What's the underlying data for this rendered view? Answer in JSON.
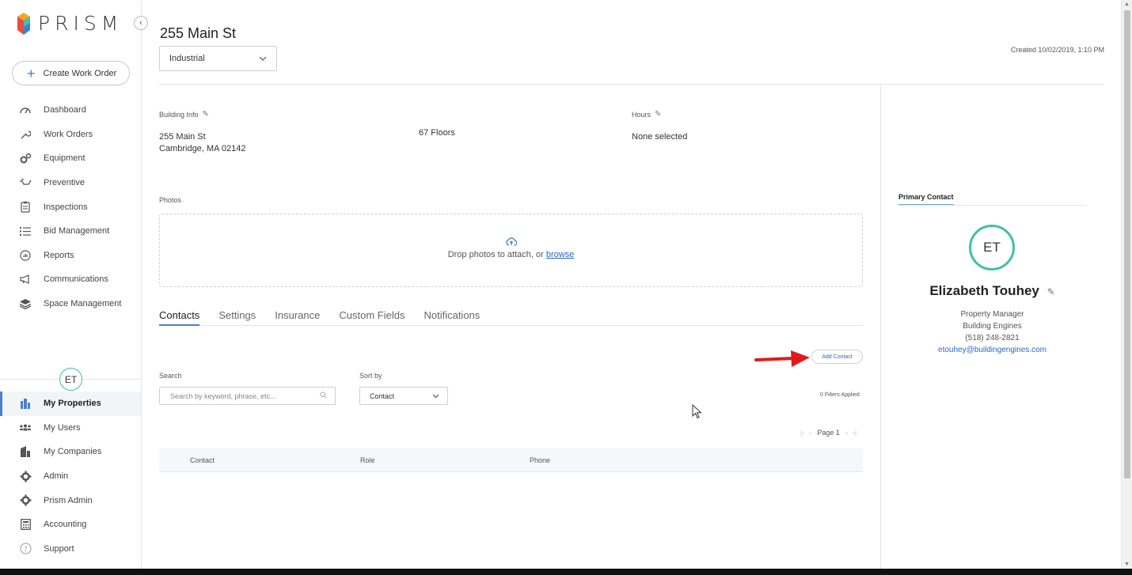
{
  "app": {
    "logo_text": "PRISM"
  },
  "sidebar": {
    "create_label": "Create Work Order",
    "nav": [
      {
        "label": "Dashboard",
        "icon": "gauge-icon"
      },
      {
        "label": "Work Orders",
        "icon": "wrench-icon"
      },
      {
        "label": "Equipment",
        "icon": "gears-icon"
      },
      {
        "label": "Preventive",
        "icon": "oil-can-icon"
      },
      {
        "label": "Inspections",
        "icon": "clipboard-icon"
      },
      {
        "label": "Bid Management",
        "icon": "list-icon"
      },
      {
        "label": "Reports",
        "icon": "chart-icon"
      },
      {
        "label": "Communications",
        "icon": "megaphone-icon"
      },
      {
        "label": "Space Management",
        "icon": "layers-icon"
      }
    ],
    "user_initials": "ET",
    "bottom_nav": [
      {
        "label": "My Properties",
        "icon": "buildings-icon",
        "active": true
      },
      {
        "label": "My Users",
        "icon": "users-icon"
      },
      {
        "label": "My Companies",
        "icon": "company-icon"
      },
      {
        "label": "Admin",
        "icon": "gear-icon"
      },
      {
        "label": "Prism Admin",
        "icon": "gear-icon"
      },
      {
        "label": "Accounting",
        "icon": "calculator-icon"
      },
      {
        "label": "Support",
        "icon": "help-icon"
      }
    ]
  },
  "property": {
    "title": "255 Main St",
    "type": "Industrial",
    "created": "Created 10/02/2019, 1:10 PM",
    "building_info_label": "Building Info",
    "address_line1": "255 Main St",
    "address_line2": "Cambridge, MA 02142",
    "floors": "67 Floors",
    "hours_label": "Hours",
    "hours_value": "None selected",
    "photos_label": "Photos",
    "drop_text": "Drop photos to attach, or ",
    "browse": "browse"
  },
  "tabs": [
    "Contacts",
    "Settings",
    "Insurance",
    "Custom Fields",
    "Notifications"
  ],
  "contacts": {
    "add_label": "Add Contact",
    "search_label": "Search",
    "search_placeholder": "Search by keyword, phrase, etc...",
    "sort_label": "Sort by",
    "sort_value": "Contact",
    "filters": "0 Filters Applied",
    "page": "Page 1",
    "columns": [
      "Contact",
      "Role",
      "Phone"
    ]
  },
  "primary_contact": {
    "label": "Primary Contact",
    "initials": "ET",
    "name": "Elizabeth Touhey",
    "role": "Property Manager",
    "company": "Building Engines",
    "phone": "(518) 248-2821",
    "email": "etouhey@buildingengines.com"
  },
  "colors": {
    "accent": "#4a7fd4",
    "avatar_ring": "#3fc1a5",
    "link": "#2a66c8",
    "arrow": "#e01b1b"
  }
}
